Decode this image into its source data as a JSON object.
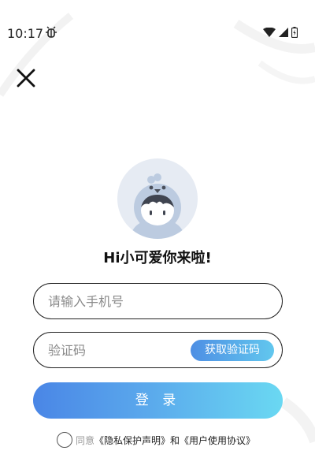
{
  "status_bar": {
    "time": "10:17",
    "icons": [
      "debug-bug-icon",
      "wifi-icon",
      "signal-icon",
      "battery-icon"
    ]
  },
  "close": {
    "icon": "close-icon"
  },
  "avatar": {
    "icon": "default-avatar-icon"
  },
  "greeting": "Hi小可爱你来啦!",
  "phone_input": {
    "placeholder": "请输入手机号",
    "value": ""
  },
  "code_input": {
    "placeholder": "验证码",
    "value": ""
  },
  "get_code_button": "获取验证码",
  "login_button": "登 录",
  "agreement": {
    "prefix": "同意",
    "privacy_link": "《隐私保护声明》",
    "joiner": "和",
    "terms_link": "《用户使用协议》",
    "checked": false
  },
  "colors": {
    "accent_start": "#4a86e6",
    "accent_end": "#6ad8f2",
    "avatar_bg": "#e6ebf3"
  }
}
